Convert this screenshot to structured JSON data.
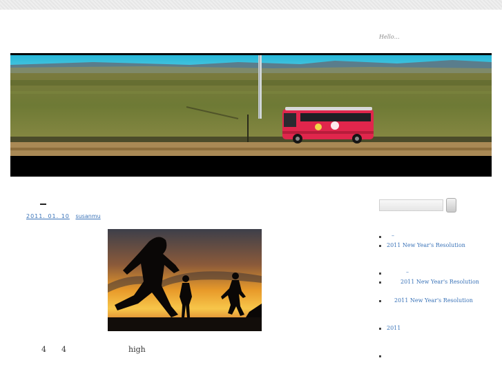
{
  "site": {
    "tagline": "Hello…"
  },
  "post": {
    "title": "–",
    "date": "2011. 01. 10",
    "author": "susanmu",
    "excerpt_parts": [
      "4",
      "4",
      "high"
    ]
  },
  "sidebar": {
    "recent_posts": [
      "–",
      "2011 New Year's Resolution"
    ],
    "recent_comments": [
      "–",
      "2011 New Year's Resolution",
      "2011 New Year's Resolution"
    ],
    "archives": [
      "2011"
    ]
  },
  "colors": {
    "link": "#3a73b8",
    "header_sky": "#3dbde0",
    "bus": "#e0264c"
  }
}
